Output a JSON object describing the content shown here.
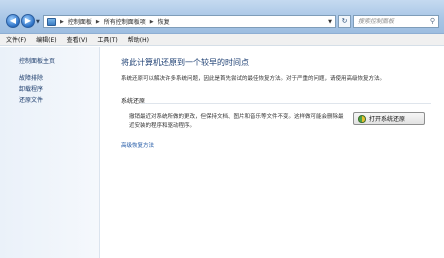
{
  "address_bar": {
    "segments": [
      "控制面板",
      "所有控制面板项",
      "恢复"
    ]
  },
  "search": {
    "placeholder": "搜索控制面板"
  },
  "menubar": {
    "items": [
      "文件(F)",
      "编辑(E)",
      "查看(V)",
      "工具(T)",
      "帮助(H)"
    ]
  },
  "sidebar": {
    "items": [
      {
        "label": "控制面板主页"
      },
      {
        "label": "故障排除"
      },
      {
        "label": "卸载程序"
      },
      {
        "label": "还原文件"
      }
    ]
  },
  "main": {
    "title": "将此计算机还原到一个较早的时间点",
    "description": "系统还原可以解决许多系统问题，因此是首先尝试的最佳恢复方法。对于严重的问题，请使用高级恢复方法。",
    "section_heading": "系统还原",
    "section_text": "撤销最近对系统所做的更改，但保持文档、图片和音乐等文件不变。这样做可能会删除最近安装的程序和驱动程序。",
    "restore_button_label": "打开系统还原",
    "advanced_link": "高级恢复方法"
  },
  "icons": {
    "back": "back-arrow-icon",
    "forward": "forward-arrow-icon",
    "refresh": "refresh-icon",
    "search": "search-icon",
    "shield": "shield-icon"
  }
}
